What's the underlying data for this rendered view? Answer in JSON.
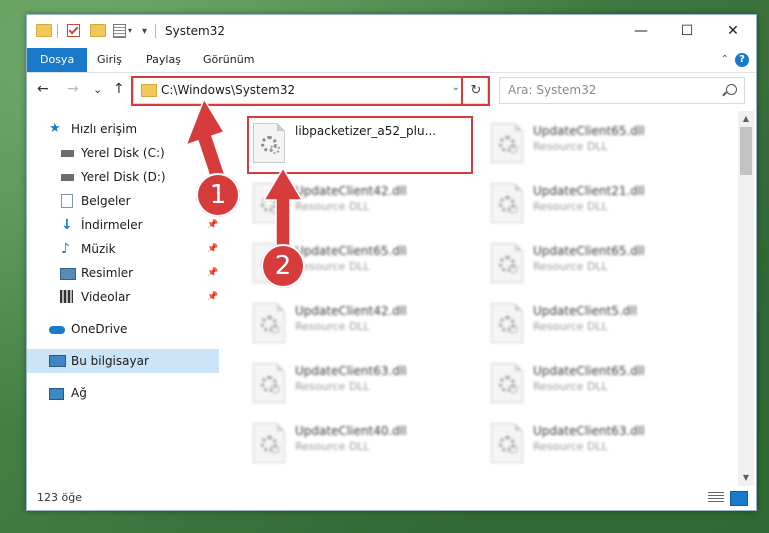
{
  "window": {
    "title": "System32",
    "minimize": "—",
    "maximize": "☐",
    "close": "✕"
  },
  "ribbon": {
    "tabs": [
      "Dosya",
      "Giriş",
      "Paylaş",
      "Görünüm"
    ],
    "help": "?",
    "collapse": "⌃"
  },
  "nav": {
    "back": "←",
    "forward": "→",
    "recent": "⌄",
    "up": "↑"
  },
  "address": {
    "path": "C:\\Windows\\System32",
    "dropdown": "⌄",
    "refresh": "↻"
  },
  "search": {
    "placeholder": "Ara: System32"
  },
  "sidebar": {
    "items": [
      {
        "label": "Hızlı erişim",
        "icon": "star-icon"
      },
      {
        "label": "Yerel Disk (C:)",
        "icon": "drive-icon"
      },
      {
        "label": "Yerel Disk (D:)",
        "icon": "drive-icon"
      },
      {
        "label": "Belgeler",
        "icon": "documents-icon"
      },
      {
        "label": "İndirmeler",
        "icon": "download-icon"
      },
      {
        "label": "Müzik",
        "icon": "music-icon"
      },
      {
        "label": "Resimler",
        "icon": "pictures-icon"
      },
      {
        "label": "Videolar",
        "icon": "video-icon"
      },
      {
        "label": "OneDrive",
        "icon": "cloud-icon"
      },
      {
        "label": "Bu bilgisayar",
        "icon": "computer-icon"
      },
      {
        "label": "Ağ",
        "icon": "network-icon"
      }
    ],
    "pin": "📌"
  },
  "files": [
    {
      "name": "libpacketizer_a52_plu...",
      "type": ""
    },
    {
      "name": "UpdateClient65.dll",
      "type": "Resource DLL"
    },
    {
      "name": "UpdateClient42.dll",
      "type": "Resource DLL"
    },
    {
      "name": "UpdateClient21.dll",
      "type": "Resource DLL"
    },
    {
      "name": "UpdateClient65.dll",
      "type": "Resource DLL"
    },
    {
      "name": "UpdateClient65.dll",
      "type": "Resource DLL"
    },
    {
      "name": "UpdateClient42.dll",
      "type": "Resource DLL"
    },
    {
      "name": "UpdateClient5.dll",
      "type": "Resource DLL"
    },
    {
      "name": "UpdateClient63.dll",
      "type": "Resource DLL"
    },
    {
      "name": "UpdateClient65.dll",
      "type": "Resource DLL"
    },
    {
      "name": "UpdateClient40.dll",
      "type": "Resource DLL"
    },
    {
      "name": "UpdateClient63.dll",
      "type": "Resource DLL"
    }
  ],
  "status": {
    "count": "123 öğe"
  },
  "callouts": {
    "one": "1",
    "two": "2"
  },
  "colors": {
    "accent": "#1979ca",
    "highlight": "#d63c3c",
    "selected": "#cce4f7"
  }
}
